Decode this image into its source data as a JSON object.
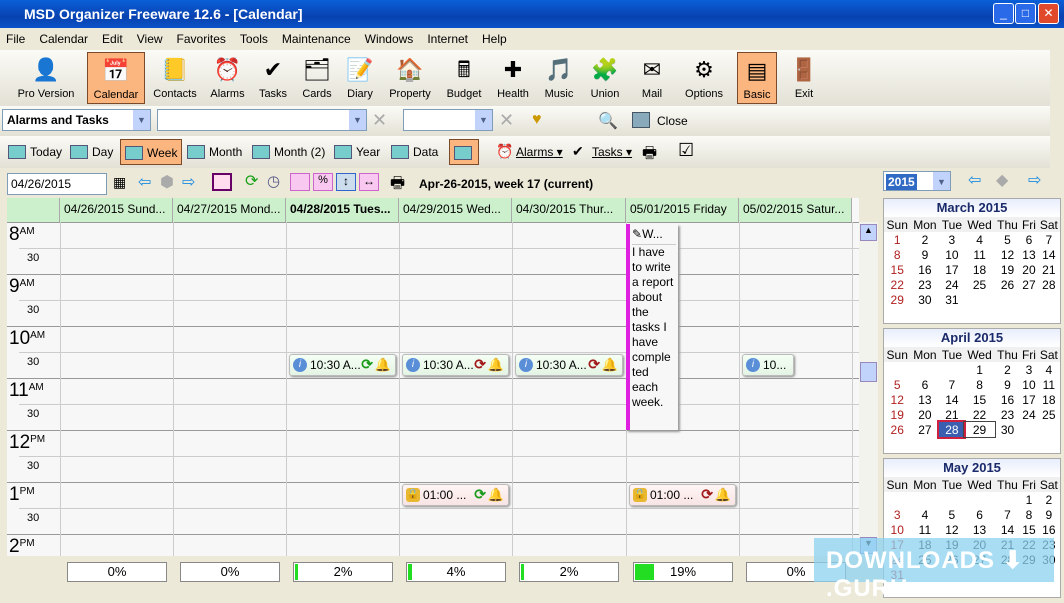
{
  "window": {
    "title": "MSD Organizer Freeware 12.6 - [Calendar]",
    "min": "_",
    "max": "□",
    "close": "✕"
  },
  "menu": [
    "File",
    "Calendar",
    "Edit",
    "View",
    "Favorites",
    "Tools",
    "Maintenance",
    "Windows",
    "Internet",
    "Help"
  ],
  "toolbar": [
    {
      "label": "Pro Version",
      "icon": "👤"
    },
    {
      "label": "Calendar",
      "icon": "📅",
      "active": true
    },
    {
      "label": "Contacts",
      "icon": "📒"
    },
    {
      "label": "Alarms",
      "icon": "⏰"
    },
    {
      "label": "Tasks",
      "icon": "✔"
    },
    {
      "label": "Cards",
      "icon": "🗂"
    },
    {
      "label": "Diary",
      "icon": "📝"
    },
    {
      "label": "Property",
      "icon": "🏠"
    },
    {
      "label": "Budget",
      "icon": "🖩"
    },
    {
      "label": "Health",
      "icon": "✚"
    },
    {
      "label": "Music",
      "icon": "🎵"
    },
    {
      "label": "Union",
      "icon": "🧩"
    },
    {
      "label": "Mail",
      "icon": "✉"
    },
    {
      "label": "Options",
      "icon": "⚙"
    },
    {
      "label": "Basic",
      "icon": "▤",
      "active": true
    },
    {
      "label": "Exit",
      "icon": "🚪"
    }
  ],
  "filter": {
    "category": "Alarms and Tasks",
    "field2": "",
    "field3": "",
    "close": "Close"
  },
  "views": [
    {
      "label": "Today"
    },
    {
      "label": "Day"
    },
    {
      "label": "Week",
      "active": true
    },
    {
      "label": "Month"
    },
    {
      "label": "Month (2)"
    },
    {
      "label": "Year"
    },
    {
      "label": "Data"
    }
  ],
  "views2": {
    "alarms": "Alarms",
    "tasks": "Tasks"
  },
  "calbar": {
    "date": "04/26/2015",
    "info": "Apr-26-2015, week 17 (current)"
  },
  "days": [
    {
      "label": "04/26/2015 Sund...",
      "pct": 0
    },
    {
      "label": "04/27/2015 Mond...",
      "pct": 0
    },
    {
      "label": "04/28/2015 Tues...",
      "pct": 2,
      "bold": true
    },
    {
      "label": "04/29/2015 Wed...",
      "pct": 4
    },
    {
      "label": "04/30/2015 Thur...",
      "pct": 2
    },
    {
      "label": "05/01/2015 Friday",
      "pct": 19
    },
    {
      "label": "05/02/2015 Satur...",
      "pct": 0
    }
  ],
  "pct_labels": [
    "0%",
    "0%",
    "2%",
    "4%",
    "2%",
    "19%",
    "0%"
  ],
  "hours": [
    {
      "h": "8",
      "ap": "AM"
    },
    {
      "h": "9",
      "ap": "AM"
    },
    {
      "h": "10",
      "ap": "AM"
    },
    {
      "h": "11",
      "ap": "AM"
    },
    {
      "h": "12",
      "ap": "PM"
    },
    {
      "h": "1",
      "ap": "PM"
    },
    {
      "h": "2",
      "ap": "PM"
    }
  ],
  "half_label": "30",
  "events": [
    {
      "day": 2,
      "text": "10:30 A...",
      "kind": "info",
      "repeat": "green"
    },
    {
      "day": 3,
      "text": "10:30 A...",
      "kind": "info",
      "repeat": "red"
    },
    {
      "day": 4,
      "text": "10:30 A...",
      "kind": "info",
      "repeat": "red"
    },
    {
      "day": 6,
      "text": "10...",
      "kind": "info"
    },
    {
      "day": 3,
      "text": "01:00 ...",
      "kind": "lock",
      "repeat": "green"
    },
    {
      "day": 5,
      "text": "01:00 ...",
      "kind": "lock",
      "repeat": "red"
    }
  ],
  "note": {
    "title": "W...",
    "body": "I have to write a report about the tasks I have comple ted each week."
  },
  "right": {
    "year": "2015",
    "weekdays": [
      "Sun",
      "Mon",
      "Tue",
      "Wed",
      "Thu",
      "Fri",
      "Sat"
    ],
    "months": [
      {
        "title": "March 2015",
        "start": 0,
        "days": 31
      },
      {
        "title": "April 2015",
        "start": 3,
        "days": 30
      },
      {
        "title": "May 2015",
        "start": 5,
        "days": 31
      }
    ]
  },
  "watermark": "DOWNLOADS ⬇ .GURU",
  "colors": {
    "accent": "#fbb57e",
    "header": "#ccf0cc",
    "note_bar": "#e020e0",
    "progress": "#22dd22"
  }
}
